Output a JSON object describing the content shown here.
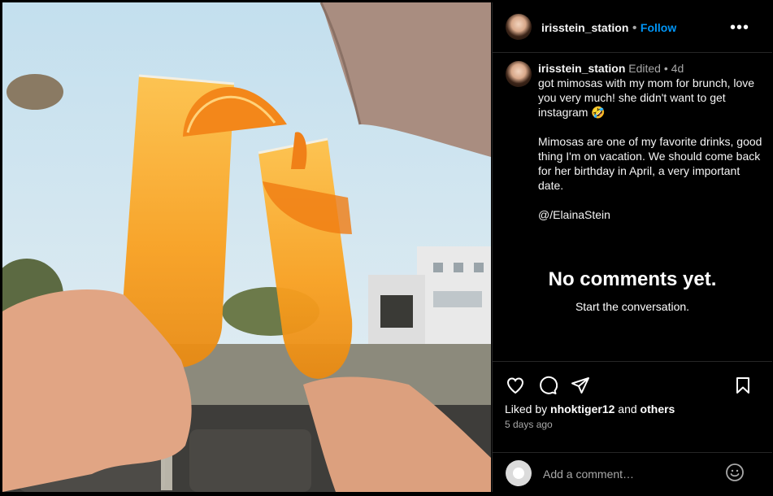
{
  "post": {
    "image_alt": "Two mimosa glasses clinking outdoors",
    "author": "irisstein_station",
    "separator": "•",
    "follow_label": "Follow",
    "more_label": "•••",
    "edited": "Edited",
    "age": "4d",
    "caption": "got mimosas with my mom for brunch, love you very much! she didn't want to get instagram 🤣\n\nMimosas are one of my favorite drinks, good thing I'm on vacation. We should come back for her birthday in April, a very important date.\n\n@/ElainaStein",
    "no_comments_title": "No comments yet.",
    "no_comments_sub": "Start the conversation.",
    "liked_by_prefix": "Liked by",
    "liked_by_user": "nhoktiger12",
    "liked_by_and": "and",
    "liked_by_others": "others",
    "posted_ago": "5 days ago",
    "comment_placeholder": "Add a comment…"
  },
  "icons": {
    "like": "heart-icon",
    "comment": "comment-bubble-icon",
    "share": "paper-plane-icon",
    "save": "bookmark-icon",
    "emoji": "smiley-icon"
  },
  "colors": {
    "accent": "#0095f6",
    "background": "#000000",
    "muted": "#a8a8a8",
    "divider": "#262626"
  }
}
